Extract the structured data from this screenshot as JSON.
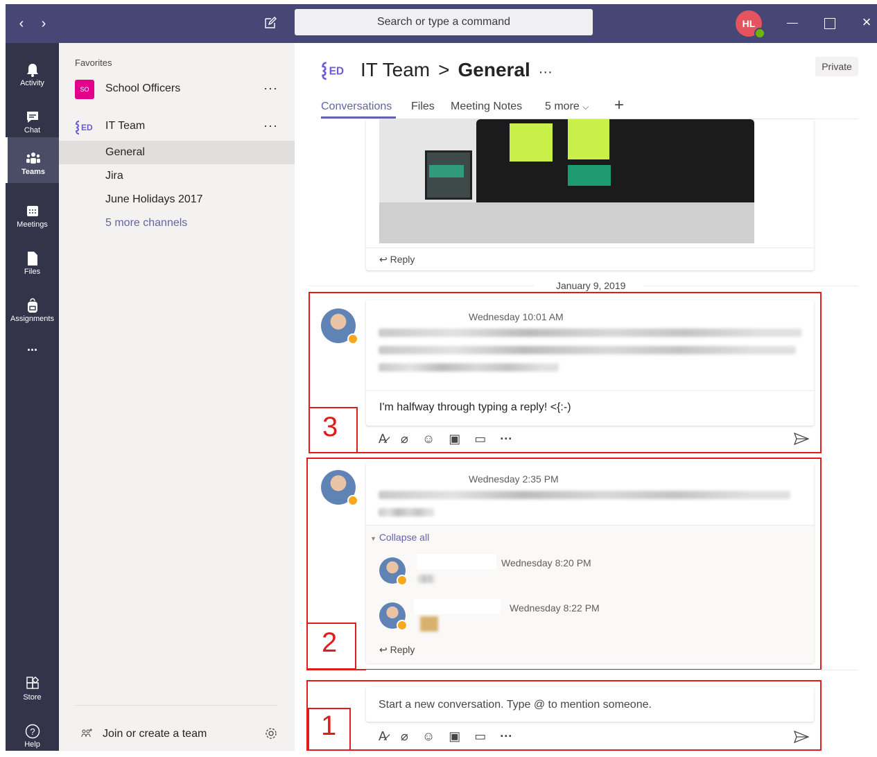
{
  "window": {
    "search_placeholder": "Search or type a command",
    "user_initials": "HL"
  },
  "app_bar": {
    "items": [
      {
        "label": "Activity",
        "icon": "bell-icon"
      },
      {
        "label": "Chat",
        "icon": "chat-icon"
      },
      {
        "label": "Teams",
        "icon": "teams-icon",
        "active": true
      },
      {
        "label": "Meetings",
        "icon": "calendar-icon"
      },
      {
        "label": "Files",
        "icon": "file-icon"
      },
      {
        "label": "Assignments",
        "icon": "backpack-icon"
      }
    ],
    "more": "...",
    "store_label": "Store",
    "help_label": "Help"
  },
  "team_list": {
    "favorites_label": "Favorites",
    "teams": [
      {
        "name": "School Officers",
        "avatar_text": "SO",
        "avatar_color": "#e3008c"
      },
      {
        "name": "IT Team"
      }
    ],
    "channels": [
      "General",
      "Jira",
      "June Holidays 2017"
    ],
    "more_channels": "5 more channels",
    "join_label": "Join or create a team"
  },
  "header": {
    "team": "IT Team",
    "separator": ">",
    "channel": "General",
    "more": "···",
    "private_badge": "Private",
    "tabs": [
      "Conversations",
      "Files",
      "Meeting Notes",
      "5 more"
    ],
    "active_tab": "Conversations",
    "add_tab": "+"
  },
  "feed": {
    "reply_label": "Reply",
    "date_divider": "January 9, 2019",
    "thread3": {
      "timestamp": "Wednesday 10:01 AM",
      "draft_reply": "I'm halfway through typing a reply! <{:-)"
    },
    "thread2": {
      "timestamp": "Wednesday 2:35 PM",
      "collapse_label": "Collapse all",
      "replies": [
        {
          "timestamp": "Wednesday 8:20 PM"
        },
        {
          "timestamp": "Wednesday 8:22 PM"
        }
      ]
    },
    "compose_placeholder": "Start a new conversation. Type @ to mention someone."
  },
  "annotations": [
    "3",
    "2",
    "1"
  ],
  "colors": {
    "accent": "#6264a7",
    "titlebar": "#464775",
    "appbar": "#33344a",
    "annotation_red": "#e01c1c"
  }
}
